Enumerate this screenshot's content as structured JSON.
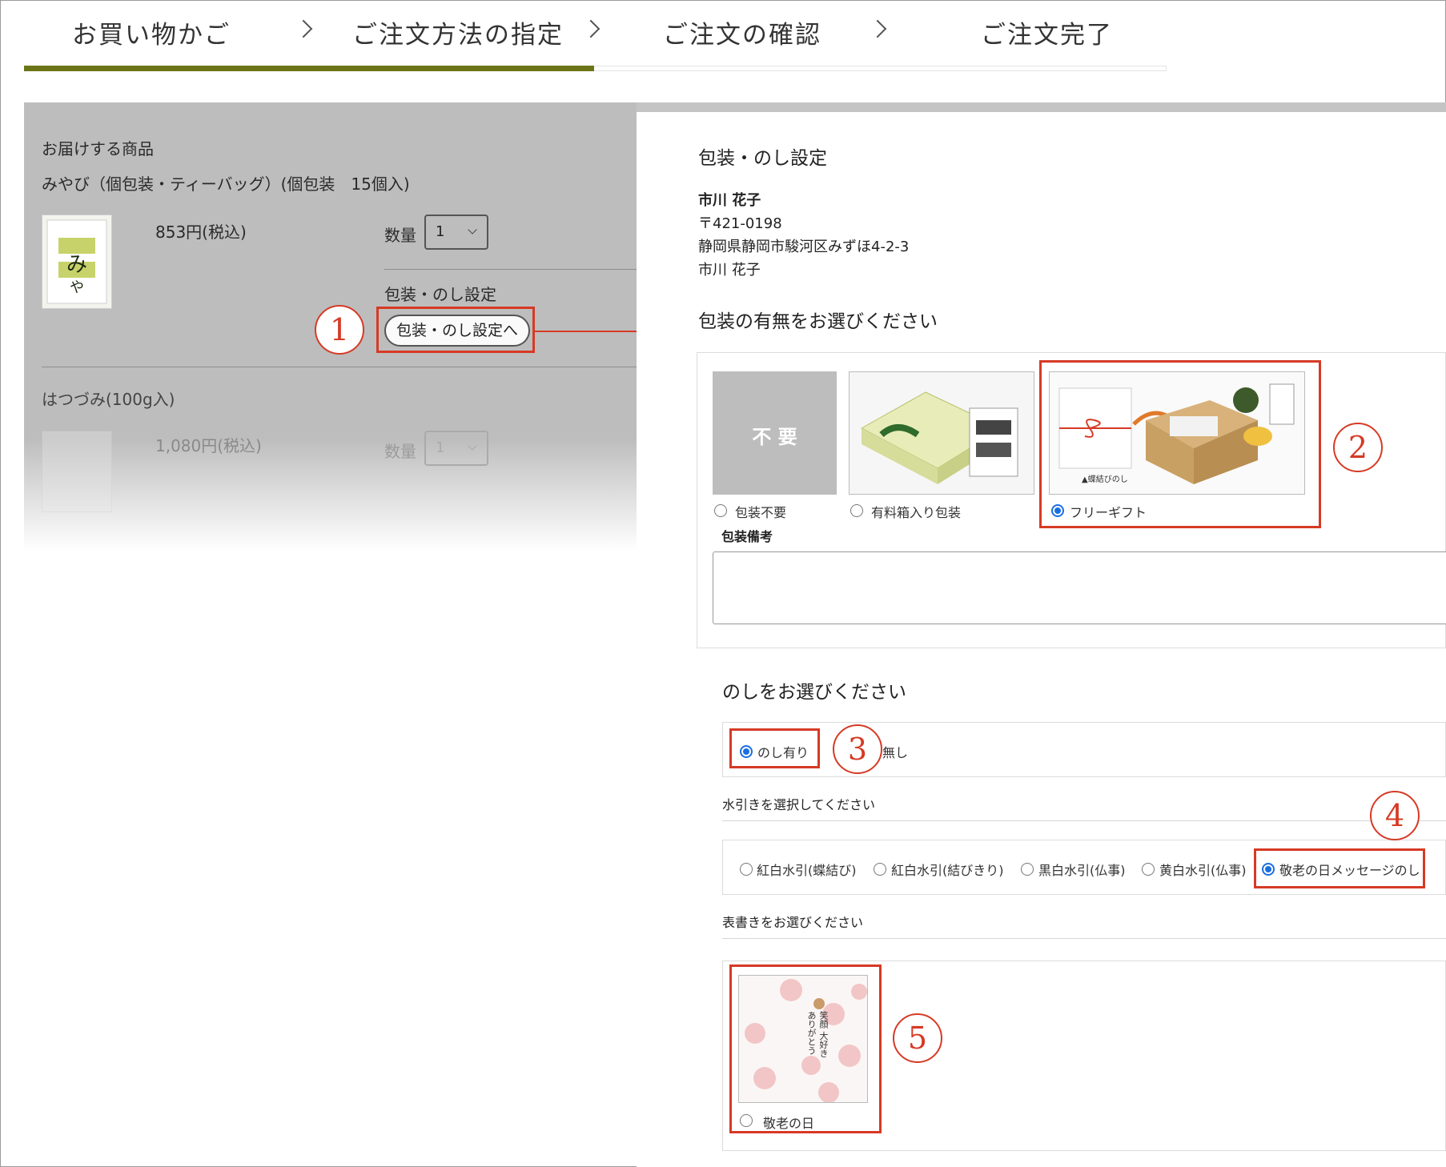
{
  "steps": {
    "items": [
      "お買い物かご",
      "ご注文方法の指定",
      "ご注文の確認",
      "ご注文完了"
    ]
  },
  "cart": {
    "section_title": "お届けする商品",
    "item1": {
      "name": "みやび（個包装・ティーバッグ）(個包装　15個入)",
      "price": "853円(税込)",
      "qty_label": "数量",
      "qty_value": "1",
      "wrap_label": "包装・のし設定",
      "wrap_button": "包装・のし設定へ"
    },
    "item2": {
      "name": "はつづみ(100g入)",
      "price": "1,080円(税込)",
      "qty_label": "数量",
      "qty_value": "1"
    }
  },
  "callouts": [
    "1",
    "2",
    "3",
    "4",
    "5"
  ],
  "modal": {
    "title": "包装・のし設定",
    "recipient": {
      "name": "市川 花子",
      "postal": "〒421-0198",
      "address": "静岡県静岡市駿河区みずほ4-2-3",
      "name2": "市川 花子"
    },
    "wrapping": {
      "heading": "包装の有無をお選びください",
      "tile_none_text": "不 要",
      "options": [
        {
          "label": "包装不要",
          "selected": false
        },
        {
          "label": "有料箱入り包装",
          "selected": false
        },
        {
          "label": "フリーギフト",
          "selected": true
        }
      ],
      "free_gift_caption": "▲蝶結びのし",
      "note_label": "包装備考",
      "note_value": ""
    },
    "noshi": {
      "heading": "のしをお選びください",
      "options": [
        {
          "label": "のし有り",
          "selected": true
        },
        {
          "label": "無し",
          "selected": false
        }
      ]
    },
    "mizuhiki": {
      "heading": "水引きを選択してください",
      "options": [
        {
          "label": "紅白水引(蝶結び)",
          "selected": false
        },
        {
          "label": "紅白水引(結びきり)",
          "selected": false
        },
        {
          "label": "黒白水引(仏事)",
          "selected": false
        },
        {
          "label": "黄白水引(仏事)",
          "selected": false
        },
        {
          "label": "敬老の日メッセージのし",
          "selected": true
        }
      ]
    },
    "omote": {
      "heading": "表書きをお選びください",
      "card_text": [
        "笑顔",
        "大好き",
        "ありがとう"
      ],
      "options": [
        {
          "label": "敬老の日",
          "selected": false
        }
      ]
    }
  },
  "colors": {
    "accent": "#6b7517",
    "callout_red": "#d63a25",
    "radio_blue": "#1a6fe0"
  }
}
